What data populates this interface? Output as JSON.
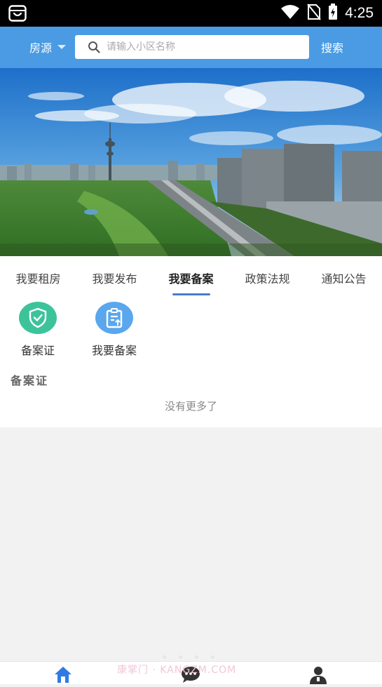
{
  "status_bar": {
    "time": "4:25",
    "app_icon": "shopping-bag-icon"
  },
  "header": {
    "city_label": "房源",
    "search_placeholder": "请输入小区名称",
    "search_button": "搜索",
    "accent_color": "#4a9be3"
  },
  "tabs": [
    {
      "label": "我要租房",
      "active": false
    },
    {
      "label": "我要发布",
      "active": false
    },
    {
      "label": "我要备案",
      "active": true
    },
    {
      "label": "政策法规",
      "active": false
    },
    {
      "label": "通知公告",
      "active": false
    }
  ],
  "quick_actions": [
    {
      "label": "备案证",
      "icon": "shield-check-icon",
      "color": "#3cc39a"
    },
    {
      "label": "我要备案",
      "icon": "clipboard-upload-icon",
      "color": "#5aa7ee"
    }
  ],
  "section": {
    "title": "备案证",
    "empty_text": "没有更多了"
  },
  "bottom_nav": [
    {
      "icon": "home-icon",
      "active": true
    },
    {
      "icon": "chat-icon",
      "active": false
    },
    {
      "icon": "user-icon",
      "active": false
    }
  ],
  "watermark": "康掌门 · KANGZM.COM"
}
